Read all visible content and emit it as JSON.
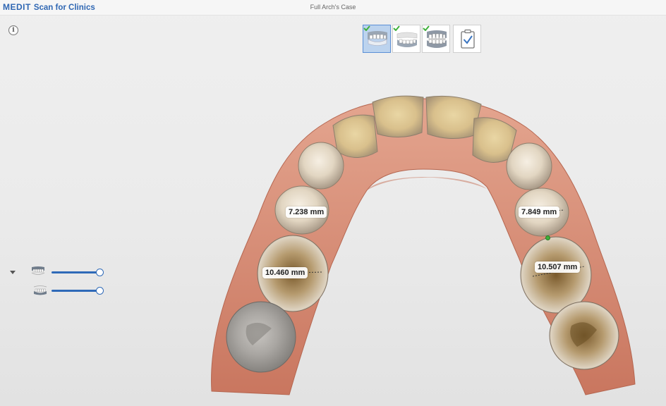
{
  "app": {
    "brand": "MEDIT",
    "product": "Scan for Clinics",
    "case_title": "Full Arch's Case"
  },
  "stages": [
    {
      "name": "maxilla",
      "completed": true,
      "active": true
    },
    {
      "name": "mandible",
      "completed": true,
      "active": false
    },
    {
      "name": "occlusion",
      "completed": true,
      "active": false
    },
    {
      "name": "review",
      "completed": false,
      "active": false
    }
  ],
  "visibility": {
    "maxilla_opacity": 1.0,
    "mandible_opacity": 1.0
  },
  "measurements": [
    {
      "label": "7.238 mm"
    },
    {
      "label": "7.849 mm"
    },
    {
      "label": "10.460 mm"
    },
    {
      "label": "10.507 mm"
    }
  ],
  "colors": {
    "accent": "#2f6ab8",
    "brand": "#2f67b3",
    "check": "#3fb03a",
    "gingiva": "#d98a72",
    "tooth": "#e9dfd0"
  }
}
